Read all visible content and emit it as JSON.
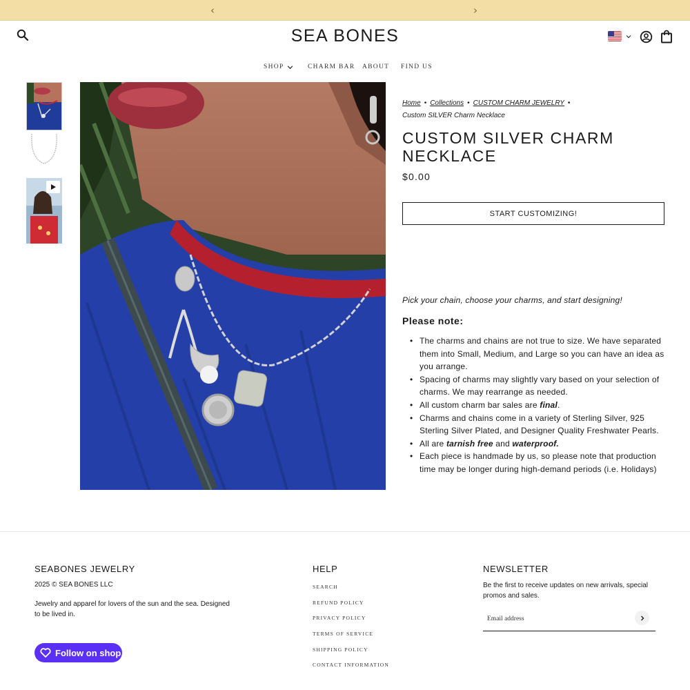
{
  "announcement": {
    "prev_icon": "chevron-left-icon",
    "next_icon": "chevron-right-icon"
  },
  "header": {
    "logo": "SEA BONES",
    "search_icon": "search-icon",
    "country_icon": "us-flag-icon",
    "account_icon": "account-icon",
    "cart_icon": "cart-icon"
  },
  "nav": {
    "items": [
      {
        "label": "SHOP"
      },
      {
        "label": "CHARM BAR"
      },
      {
        "label": "ABOUT"
      },
      {
        "label": "FIND US"
      }
    ]
  },
  "breadcrumb": {
    "home": "Home",
    "collections": "Collections",
    "category": "CUSTOM CHARM JEWELRY",
    "current": "Custom SILVER Charm Necklace"
  },
  "product": {
    "title": "CUSTOM SILVER CHARM NECKLACE",
    "price": "$0.00",
    "cta": "START CUSTOMIZING!",
    "intro": "Pick your chain, choose your charms, and start designing!",
    "note_heading": "Please note:",
    "notes": {
      "n1": "The charms and chains are not true to size. We have separated them into Small, Medium, and Large so you can have an idea as you arrange.",
      "n2": "Spacing of charms may slightly vary based on your selection of charms.  We may rearrange as needed.",
      "n3_a": "All custom charm bar sales are ",
      "n3_b": "final",
      "n3_c": ".",
      "n4": "Charms and chains come in a variety of Sterling Silver, 925 Sterling Silver Plated,  and Designer Quality Freshwater Pearls.",
      "n5_a": "All are ",
      "n5_b": "tarnish free",
      "n5_c": " and ",
      "n5_d": "waterproof.",
      "n6": "Each piece is handmade by us, so please note that production time may be longer during high-demand periods (i.e. Holidays)"
    }
  },
  "footer": {
    "brand_heading": "SEABONES JEWELRY",
    "copyright": "2025 © SEA BONES LLC",
    "about": "Jewelry and apparel for lovers of the sun and the sea. Designed to be lived in.",
    "follow_label": "Follow on shop",
    "help_heading": "HELP",
    "help_links": [
      "SEARCH",
      "REFUND POLICY",
      "PRIVACY POLICY",
      "TERMS OF SERVICE",
      "SHIPPING POLICY",
      "CONTACT INFORMATION"
    ],
    "newsletter_heading": "NEWSLETTER",
    "newsletter_desc": "Be the first to receive updates on new arrivals, special promos and sales.",
    "email_placeholder": "Email address"
  },
  "colors": {
    "announcement_bg": "#f3dfa6",
    "shop_purple": "#5a31f4"
  }
}
